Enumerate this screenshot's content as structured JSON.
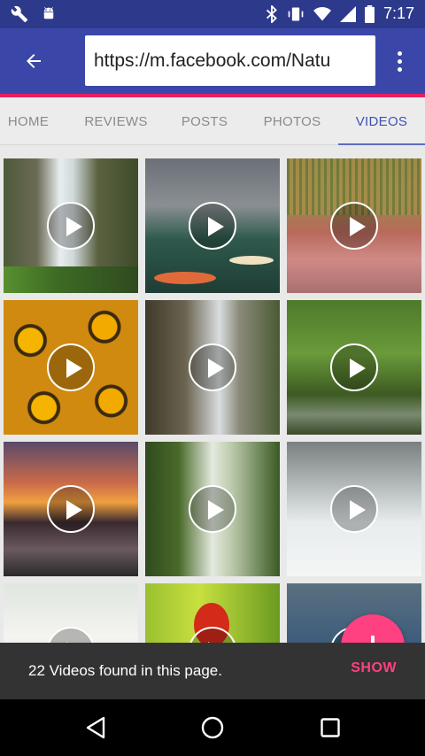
{
  "status_bar": {
    "time": "7:17",
    "icons": [
      "wrench-icon",
      "android-icon",
      "bluetooth-icon",
      "vibrate-icon",
      "wifi-icon",
      "signal-icon",
      "battery-icon"
    ]
  },
  "toolbar": {
    "back_icon": "arrow-left-icon",
    "url": "https://m.facebook.com/Natu",
    "menu_icon": "more-vertical-icon",
    "colors": {
      "status": "#2d3a8c",
      "bar": "#3a47a8",
      "accent": "#e91e63"
    }
  },
  "tabs": [
    {
      "label": "HOME",
      "active": false
    },
    {
      "label": "REVIEWS",
      "active": false
    },
    {
      "label": "POSTS",
      "active": false
    },
    {
      "label": "PHOTOS",
      "active": false
    },
    {
      "label": "VIDEOS",
      "active": true
    }
  ],
  "videos": [
    {
      "scene": "waterfall-cliff"
    },
    {
      "scene": "koi-pond"
    },
    {
      "scene": "flamingos"
    },
    {
      "scene": "sunflowers"
    },
    {
      "scene": "waterfall-rocks"
    },
    {
      "scene": "forest-stream"
    },
    {
      "scene": "sunset-lake"
    },
    {
      "scene": "waterfall-green"
    },
    {
      "scene": "rapids"
    },
    {
      "scene": "tulips"
    },
    {
      "scene": "parrot"
    },
    {
      "scene": "duck-water"
    }
  ],
  "snackbar": {
    "message": "22 Videos found in this page.",
    "action": "SHOW",
    "action_color": "#ff4081"
  },
  "fab": {
    "icon": "download-icon",
    "color": "#ff4081"
  },
  "nav_bar": {
    "icons": [
      "back-triangle-icon",
      "home-circle-icon",
      "recents-square-icon"
    ]
  }
}
